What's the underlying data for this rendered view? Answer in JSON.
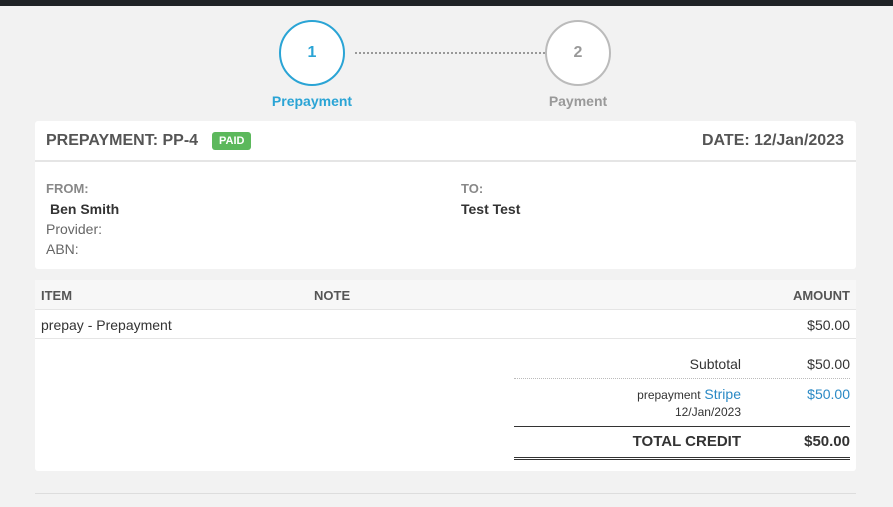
{
  "stepper": {
    "steps": [
      {
        "number": "1",
        "label": "Prepayment",
        "active": true
      },
      {
        "number": "2",
        "label": "Payment",
        "active": false
      }
    ]
  },
  "header": {
    "title": "PREPAYMENT: PP-4",
    "status_badge": "PAID",
    "date": "DATE: 12/Jan/2023"
  },
  "parties": {
    "from_label": "FROM:",
    "from_name": "Ben Smith",
    "provider_label": "Provider:",
    "abn_label": "ABN:",
    "to_label": "TO:",
    "to_name": "Test Test"
  },
  "table": {
    "columns": [
      "ITEM",
      "NOTE",
      "AMOUNT"
    ],
    "rows": [
      {
        "item": "prepay - Prepayment",
        "note": "",
        "amount": "$50.00"
      }
    ]
  },
  "totals": {
    "subtotal_label": "Subtotal",
    "subtotal_value": "$50.00",
    "payment_prefix": "prepayment",
    "payment_method": "Stripe",
    "payment_date": "12/Jan/2023",
    "payment_value": "$50.00",
    "total_label": "TOTAL CREDIT",
    "total_value": "$50.00"
  },
  "colors": {
    "accent": "#2aa4d5",
    "badge_paid": "#5cb85c",
    "link": "#2a89c5"
  }
}
